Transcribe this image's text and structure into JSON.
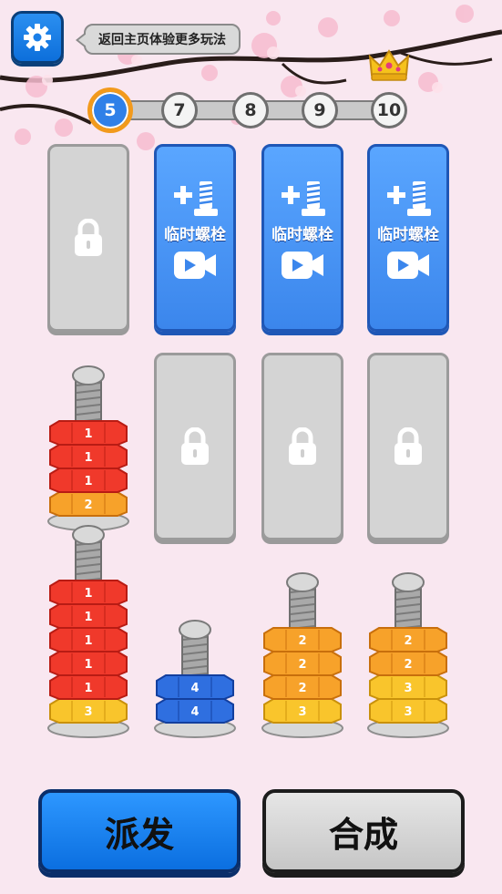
{
  "header": {
    "settings_icon": "gear-icon",
    "tip_text": "返回主页体验更多玩法",
    "crown_icon": "crown-icon"
  },
  "levels": [
    {
      "label": "5",
      "current": true
    },
    {
      "label": "7",
      "current": false
    },
    {
      "label": "8",
      "current": false
    },
    {
      "label": "9",
      "current": false
    },
    {
      "label": "10",
      "current": false
    }
  ],
  "temp_slot_label": "临时螺栓",
  "board": {
    "row1": [
      "locked",
      "temp",
      "temp",
      "temp"
    ],
    "row2": [
      {
        "nuts": [
          "2",
          "1",
          "1",
          "1"
        ]
      },
      "locked",
      "locked",
      "locked"
    ],
    "row3": [
      {
        "nuts": [
          "3",
          "1",
          "1",
          "1",
          "1",
          "1"
        ]
      },
      {
        "nuts": [
          "4",
          "4"
        ]
      },
      {
        "nuts": [
          "3",
          "2",
          "2",
          "2"
        ]
      },
      {
        "nuts": [
          "3",
          "3",
          "2",
          "2"
        ]
      }
    ]
  },
  "buttons": {
    "dispatch": "派发",
    "merge": "合成"
  },
  "colors": {
    "nut_1": "#e8261d",
    "nut_2": "#f4931a",
    "nut_3": "#f6b91b",
    "nut_4": "#1e5fd4",
    "accent": "#2f80e8"
  }
}
